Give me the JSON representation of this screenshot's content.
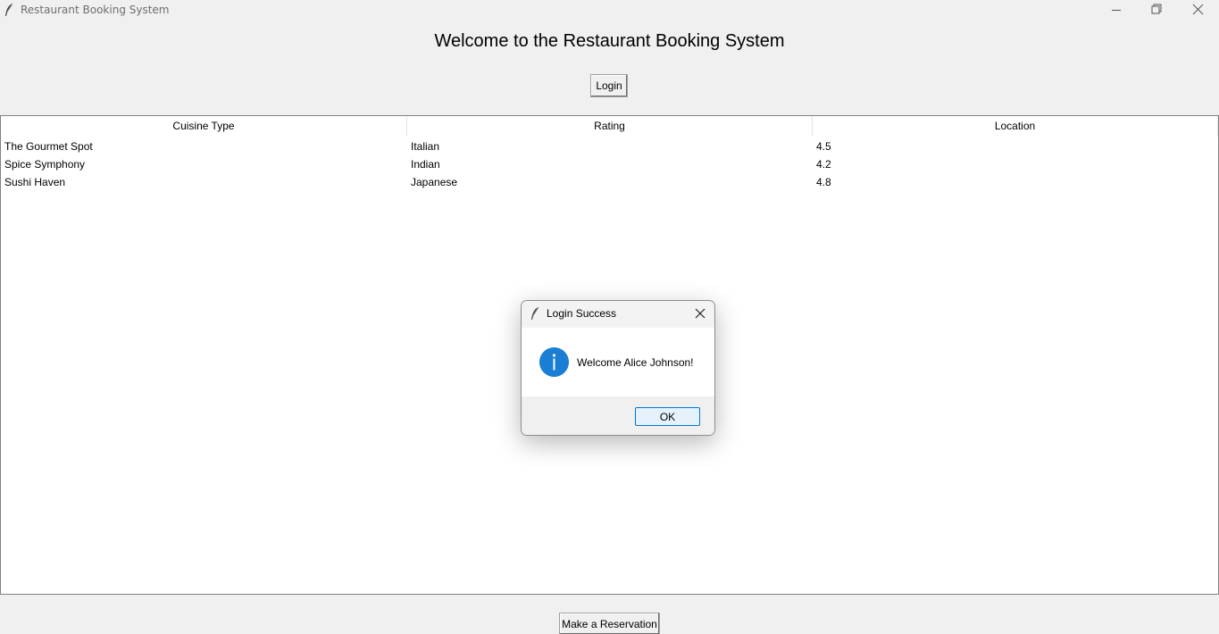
{
  "window": {
    "title": "Restaurant Booking System"
  },
  "main": {
    "heading": "Welcome to the Restaurant Booking System",
    "login_label": "Login",
    "reserve_label": "Make a Reservation"
  },
  "table": {
    "columns": [
      "Cuisine Type",
      "Rating",
      "Location"
    ],
    "rows": [
      [
        "The Gourmet Spot",
        "Italian",
        "4.5"
      ],
      [
        "Spice Symphony",
        "Indian",
        "4.2"
      ],
      [
        "Sushi Haven",
        "Japanese",
        "4.8"
      ]
    ]
  },
  "dialog": {
    "title": "Login Success",
    "message": "Welcome Alice Johnson!",
    "ok_label": "OK",
    "icon": "info-icon"
  },
  "colors": {
    "info_blue": "#1a7fd4",
    "ok_border": "#0078d7"
  }
}
